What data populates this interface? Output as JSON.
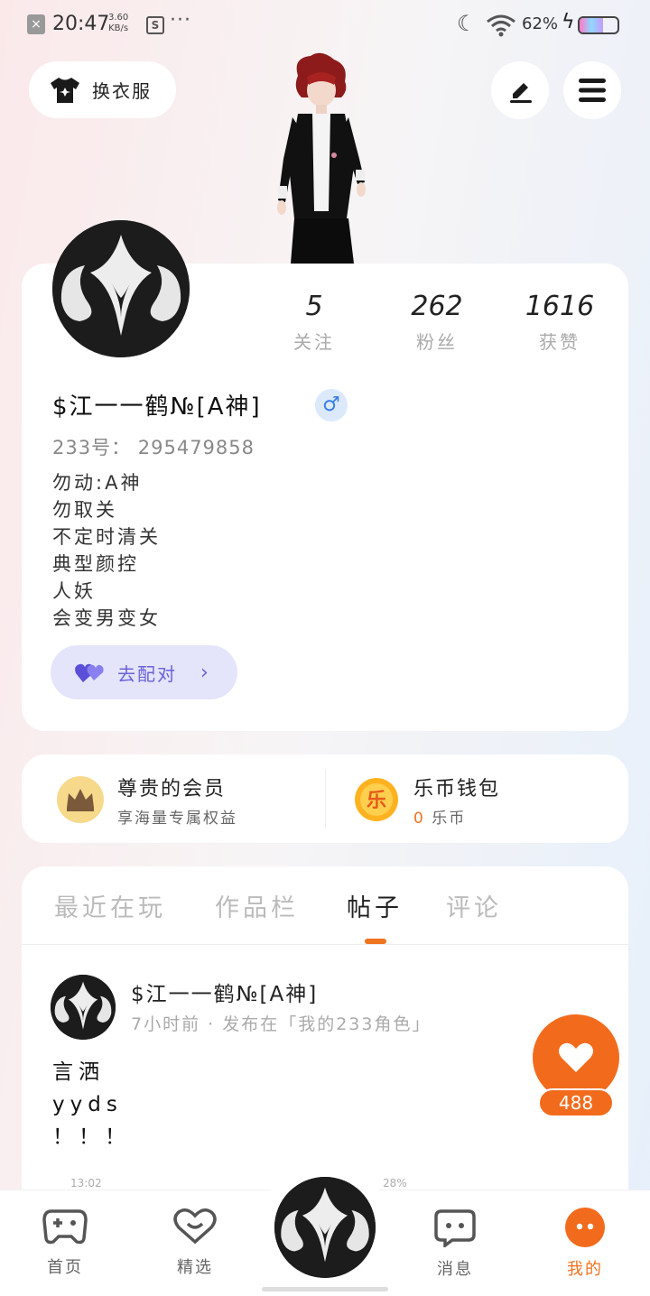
{
  "status_bar": {
    "time": "20:47",
    "net_speed_value": "3.60",
    "net_speed_unit": "KB/s",
    "battery": "62%"
  },
  "header": {
    "outfit_label": "换衣服",
    "edit_icon": "pencil-icon",
    "menu_icon": "menu-icon"
  },
  "profile": {
    "stats": [
      {
        "value": "5",
        "label": "关注"
      },
      {
        "value": "262",
        "label": "粉丝"
      },
      {
        "value": "1616",
        "label": "获赞"
      }
    ],
    "nickname": "$江一一鹤№[A神]",
    "gender_symbol": "♂",
    "id_line": "233号：  295479858",
    "bio_lines": [
      "勿动:A神",
      "勿取关",
      "不定时清关",
      "典型颜控",
      "人妖",
      "会变男变女"
    ],
    "match_label": "去配对"
  },
  "vip": {
    "member_title": "尊贵的会员",
    "member_sub": "享海量专属权益",
    "wallet_title": "乐币钱包",
    "wallet_amount": "0",
    "wallet_unit": "乐币",
    "coin_glyph": "乐"
  },
  "tabs": [
    {
      "label": "最近在玩",
      "active": false
    },
    {
      "label": "作品栏",
      "active": false
    },
    {
      "label": "帖子",
      "active": true
    },
    {
      "label": "评论",
      "active": false
    }
  ],
  "post": {
    "author": "$江一一鹤№[A神]",
    "meta": "7小时前 · 发布在「我的233角色」",
    "body_lines": [
      "言洒",
      "yyds",
      "！！！"
    ],
    "like_count": "488"
  },
  "ghost_overlay": {
    "time": "13:02",
    "battery": "28%"
  },
  "bottom_nav": [
    {
      "label": "首页",
      "icon": "gamepad-icon",
      "active": false
    },
    {
      "label": "精选",
      "icon": "heart-chat-icon",
      "active": false
    },
    {
      "label": "消息",
      "icon": "message-icon",
      "active": false
    },
    {
      "label": "我的",
      "icon": "profile-face-icon",
      "active": true
    }
  ],
  "colors": {
    "accent": "#f07320",
    "match_text": "#6a63d6",
    "gender": "#3b7fe6"
  }
}
